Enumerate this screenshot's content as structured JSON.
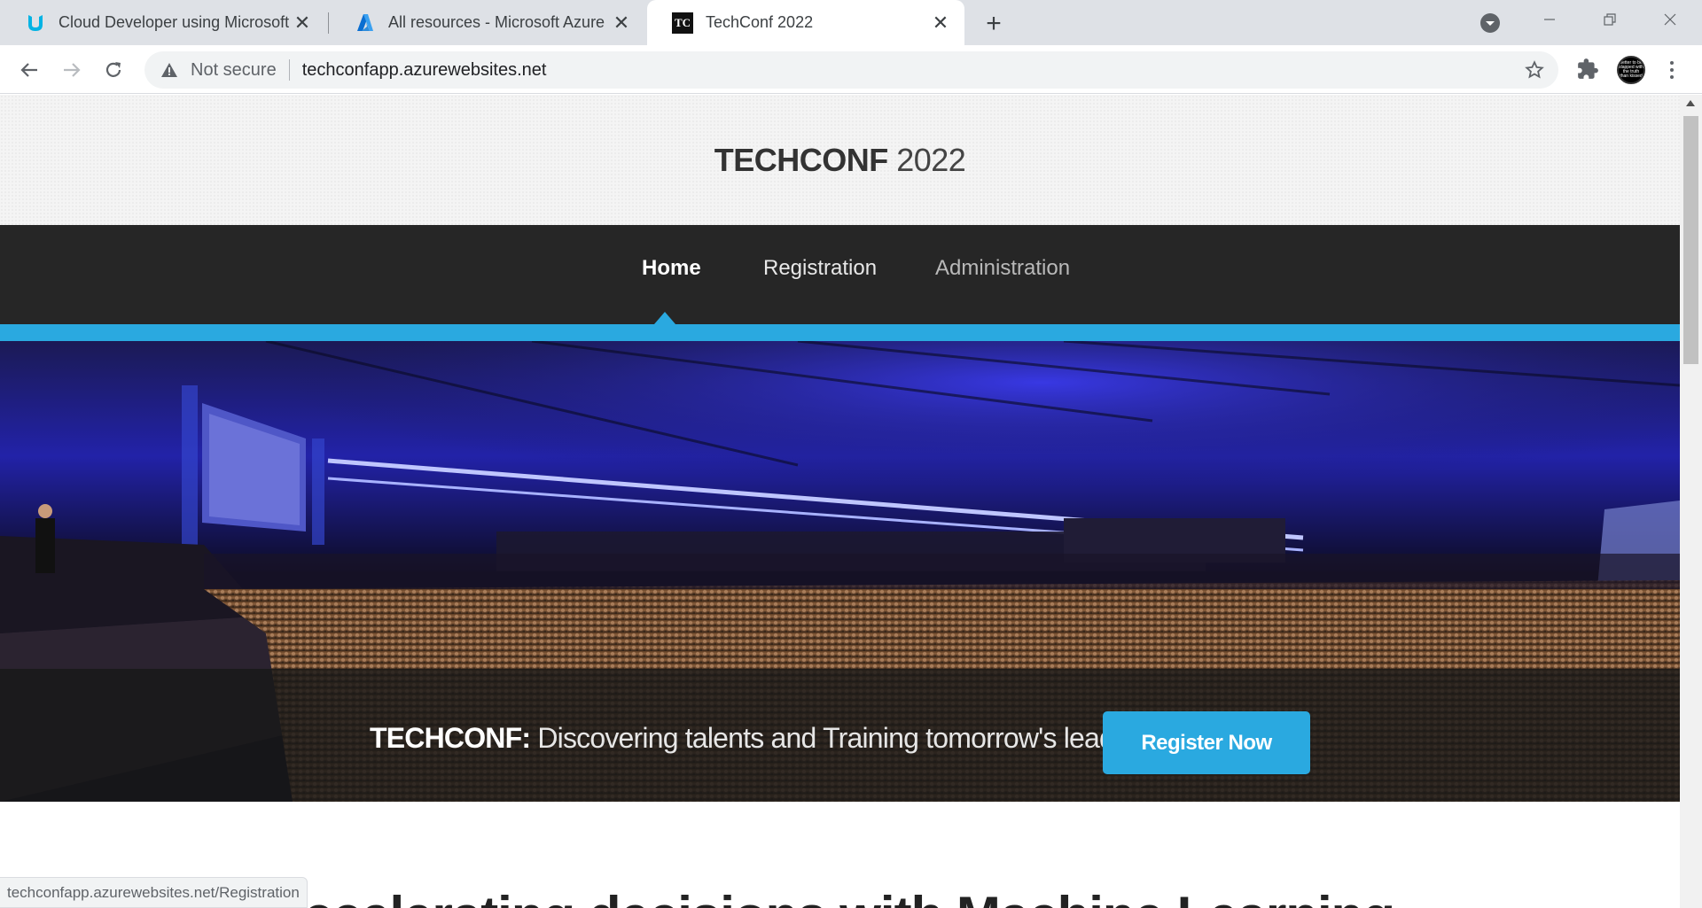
{
  "browser": {
    "tabs": [
      {
        "title": "Cloud Developer using Microsoft Azure",
        "favicon": "udacity-icon",
        "active": false
      },
      {
        "title": "All resources - Microsoft Azure",
        "favicon": "azure-icon",
        "active": false
      },
      {
        "title": "TechConf 2022",
        "favicon": "techconf-icon",
        "favicon_text": "TC",
        "active": true
      }
    ],
    "security_label": "Not secure",
    "url": "techconfapp.azurewebsites.net",
    "avatar_text": "better to be slapped with the truth than kissed",
    "status_url": "techconfapp.azurewebsites.net/Registration"
  },
  "site": {
    "brand_bold": "TECHCONF",
    "brand_year": " 2022",
    "nav": [
      {
        "label": "Home",
        "state": "active"
      },
      {
        "label": "Registration",
        "state": "normal"
      },
      {
        "label": "Administration",
        "state": "muted"
      }
    ],
    "hero": {
      "tagline_lead": "TECHCONF:",
      "tagline_rest": " Discovering talents and Training tomorrow's leaders",
      "cta_label": "Register Now"
    },
    "next_section_heading": "Accelerating decisions with Machine Learning"
  },
  "colors": {
    "accent": "#2aa9e0",
    "nav_background": "#262626",
    "header_background": "#f4f4f4"
  }
}
